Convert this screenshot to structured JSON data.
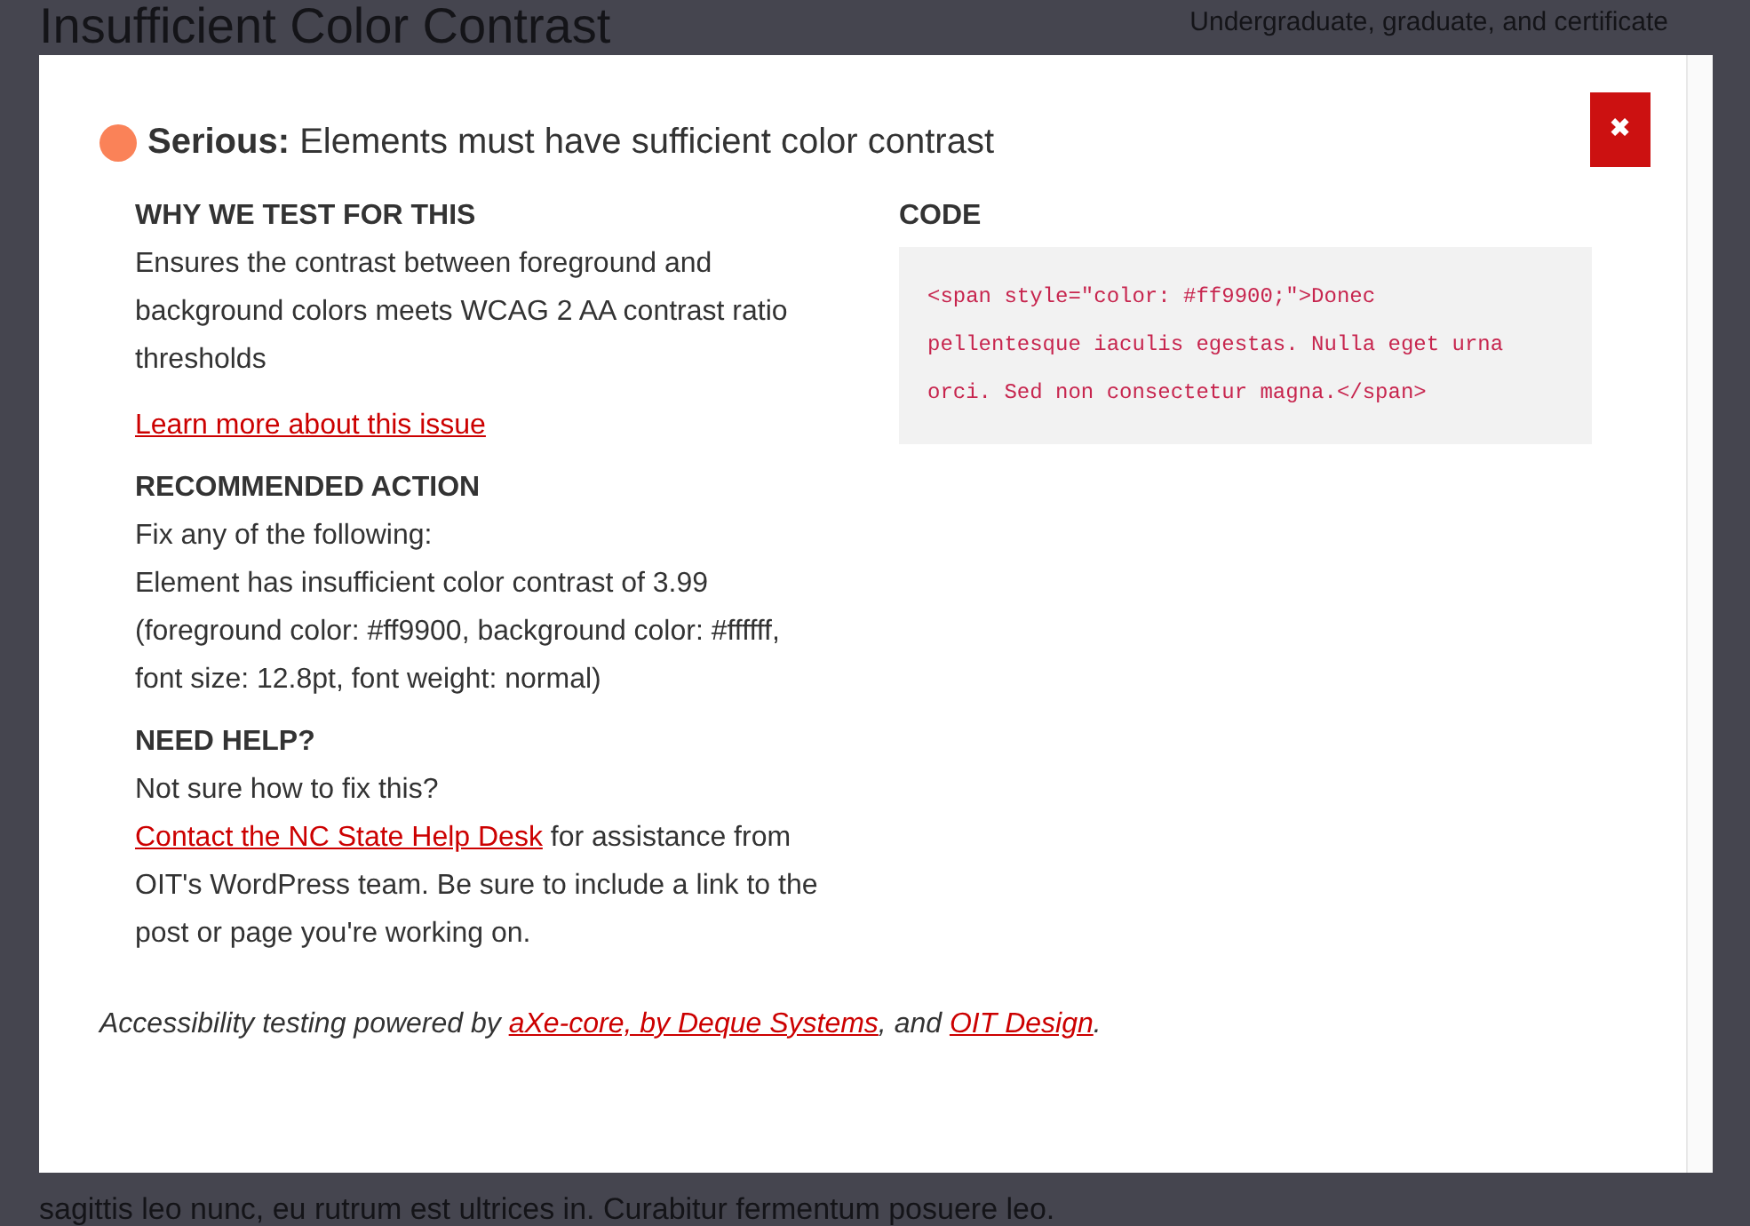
{
  "background_page": {
    "heading": "Insufficient Color Contrast",
    "sidebar_text": "Undergraduate, graduate, and certificate",
    "body_text": "sagittis leo nunc, eu rutrum est ultrices in. Curabitur fermentum posuere leo."
  },
  "modal": {
    "severity": {
      "label": "Serious:",
      "color": "#fa8258"
    },
    "title": "Elements must have sufficient color contrast",
    "close_button": "✖",
    "sections": [
      {
        "heading": "WHY WE TEST FOR THIS",
        "paragraphs": [
          [
            {
              "kind": "text",
              "text": "Ensures the contrast between foreground and background colors meets WCAG 2 AA contrast ratio thresholds"
            }
          ],
          [
            {
              "kind": "link",
              "text": "Learn more about this issue"
            }
          ]
        ]
      },
      {
        "heading": "RECOMMENDED ACTION",
        "paragraphs": [
          [
            {
              "kind": "text",
              "text": "Fix any of the following:"
            }
          ],
          [
            {
              "kind": "text",
              "text": "Element has insufficient color contrast of 3.99 (foreground color: #ff9900, background color: #ffffff, font size: 12.8pt, font weight: normal)"
            }
          ]
        ]
      },
      {
        "heading": "NEED HELP?",
        "paragraphs": [
          [
            {
              "kind": "text",
              "text": "Not sure how to fix this? "
            },
            {
              "kind": "link",
              "text": "Contact the NC State Help Desk"
            },
            {
              "kind": "text",
              "text": " for assistance from OIT's WordPress team. Be sure to include a link to the post or page you're working on."
            }
          ]
        ]
      }
    ],
    "code": {
      "heading": "CODE",
      "snippet": "<span style=\"color: #ff9900;\">Donec pellentesque iaculis egestas. Nulla eget urna orci. Sed non consectetur magna.</span>"
    },
    "footer": [
      {
        "kind": "text",
        "text": "Accessibility testing powered by "
      },
      {
        "kind": "link",
        "text": "aXe-core, by Deque Systems"
      },
      {
        "kind": "text",
        "text": ", and "
      },
      {
        "kind": "link",
        "text": "OIT Design"
      },
      {
        "kind": "text",
        "text": "."
      }
    ]
  }
}
